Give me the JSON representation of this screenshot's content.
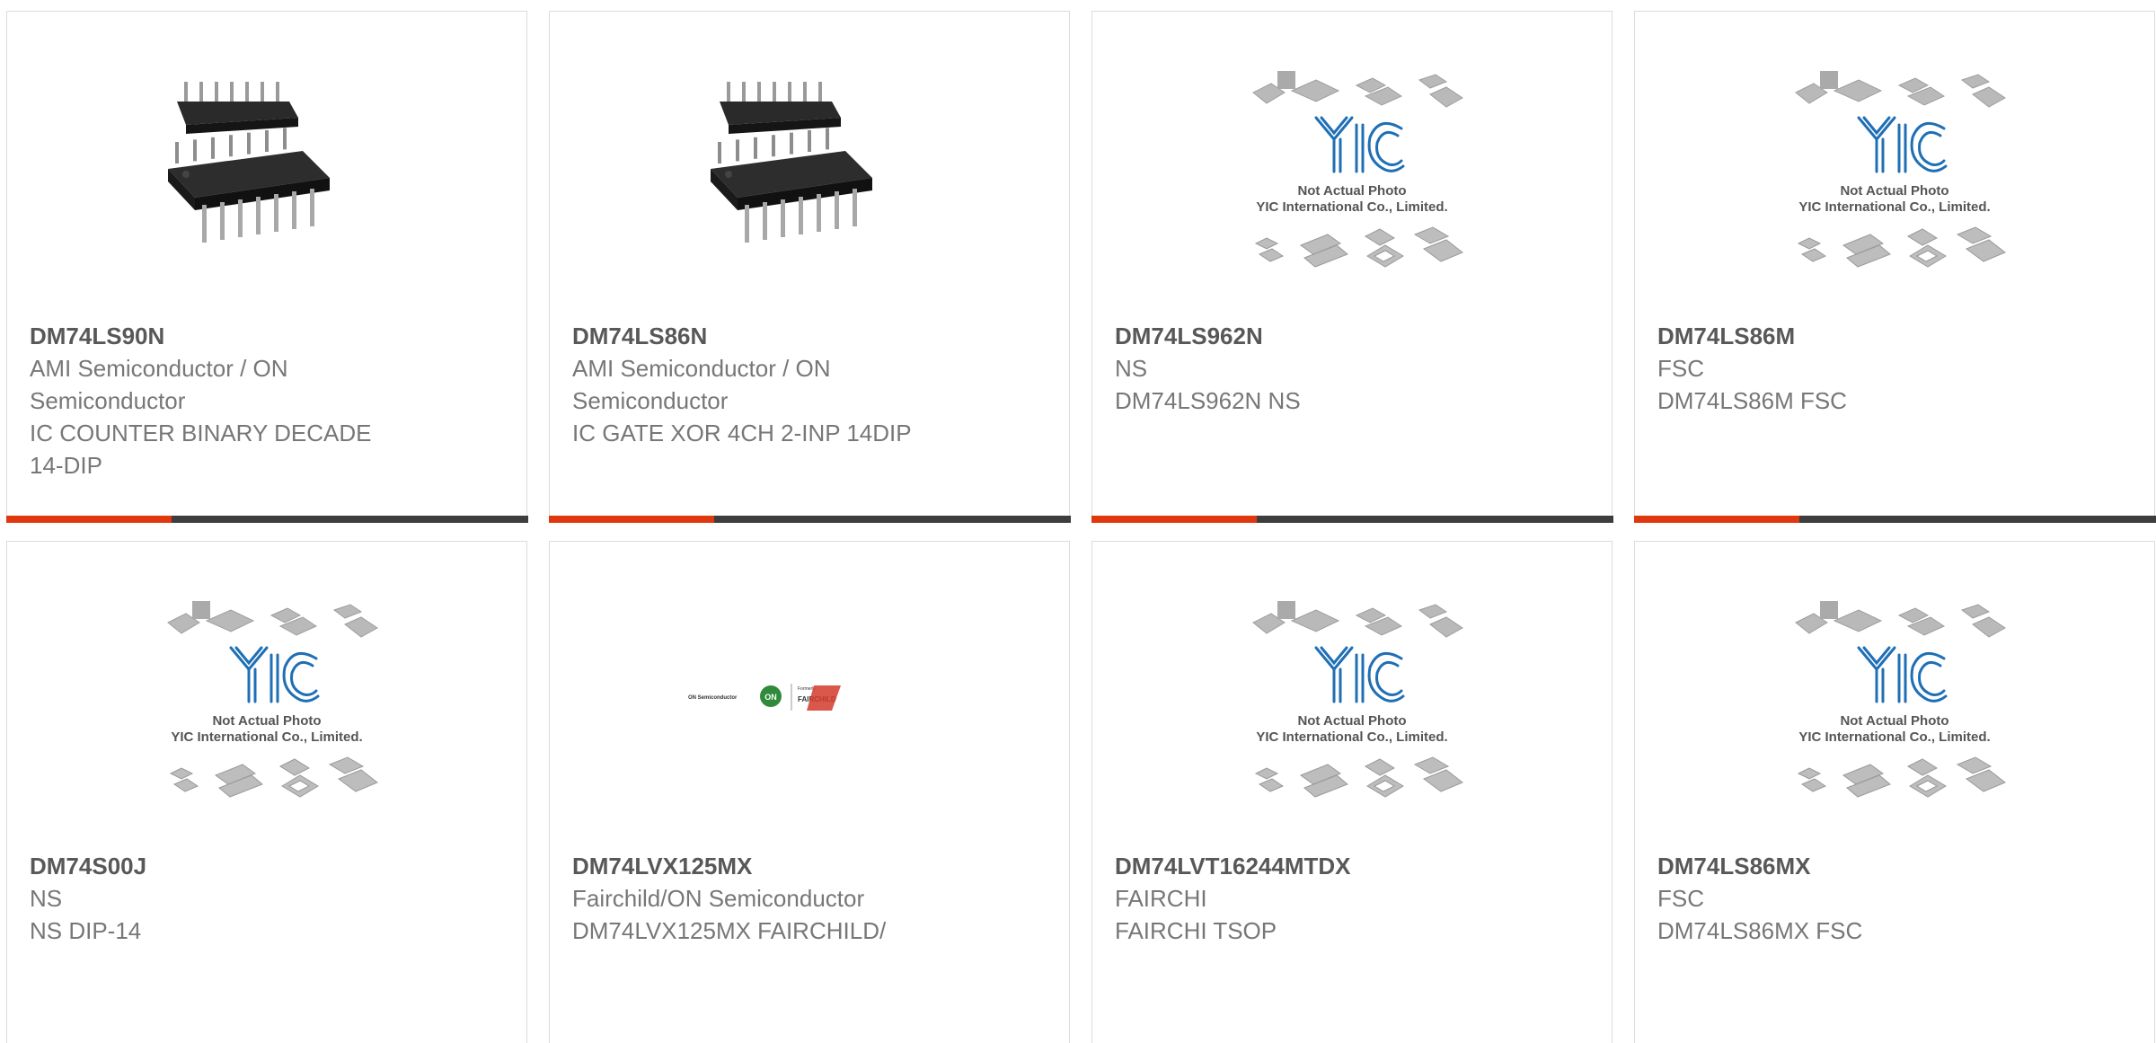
{
  "products": [
    {
      "part": "DM74LS90N",
      "lines": [
        "AMI Semiconductor / ON",
        "Semiconductor",
        "IC COUNTER BINARY DECADE",
        "14-DIP"
      ],
      "image": "dip-chip-photo",
      "image_text": []
    },
    {
      "part": "DM74LS86N",
      "lines": [
        "AMI Semiconductor / ON",
        "Semiconductor",
        "IC GATE XOR 4CH 2-INP 14DIP"
      ],
      "image": "dip-chip-photo",
      "image_text": []
    },
    {
      "part": "DM74LS962N",
      "lines": [
        "NS",
        "DM74LS962N NS"
      ],
      "image": "yic-placeholder",
      "image_text": [
        "Not Actual Photo",
        "YIC International Co., Limited."
      ]
    },
    {
      "part": "DM74LS86M",
      "lines": [
        "FSC",
        "DM74LS86M FSC"
      ],
      "image": "yic-placeholder",
      "image_text": [
        "Not Actual Photo",
        "YIC International Co., Limited."
      ]
    },
    {
      "part": "DM74S00J",
      "lines": [
        "NS",
        "NS DIP-14"
      ],
      "image": "yic-placeholder",
      "image_text": [
        "Not Actual Photo",
        "YIC International Co., Limited."
      ]
    },
    {
      "part": "DM74LVX125MX",
      "lines": [
        "Fairchild/ON Semiconductor",
        "DM74LVX125MX FAIRCHILD/"
      ],
      "image": "on-fairchild-logo",
      "image_text": [
        "ON Semiconductor",
        "ON",
        "Formerly",
        "FAIRCHILD"
      ]
    },
    {
      "part": "DM74LVT16244MTDX",
      "lines": [
        "FAIRCHI",
        "FAIRCHI TSOP"
      ],
      "image": "yic-placeholder",
      "image_text": [
        "Not Actual Photo",
        "YIC International Co., Limited."
      ]
    },
    {
      "part": "DM74LS86MX",
      "lines": [
        "FSC",
        "DM74LS86MX FSC"
      ],
      "image": "yic-placeholder",
      "image_text": [
        "Not Actual Photo",
        "YIC International Co., Limited."
      ]
    }
  ],
  "colors": {
    "accent_bar": "#e0380e",
    "dark_bar": "#3d3d3d",
    "yic_blue": "#1f6fb5"
  }
}
